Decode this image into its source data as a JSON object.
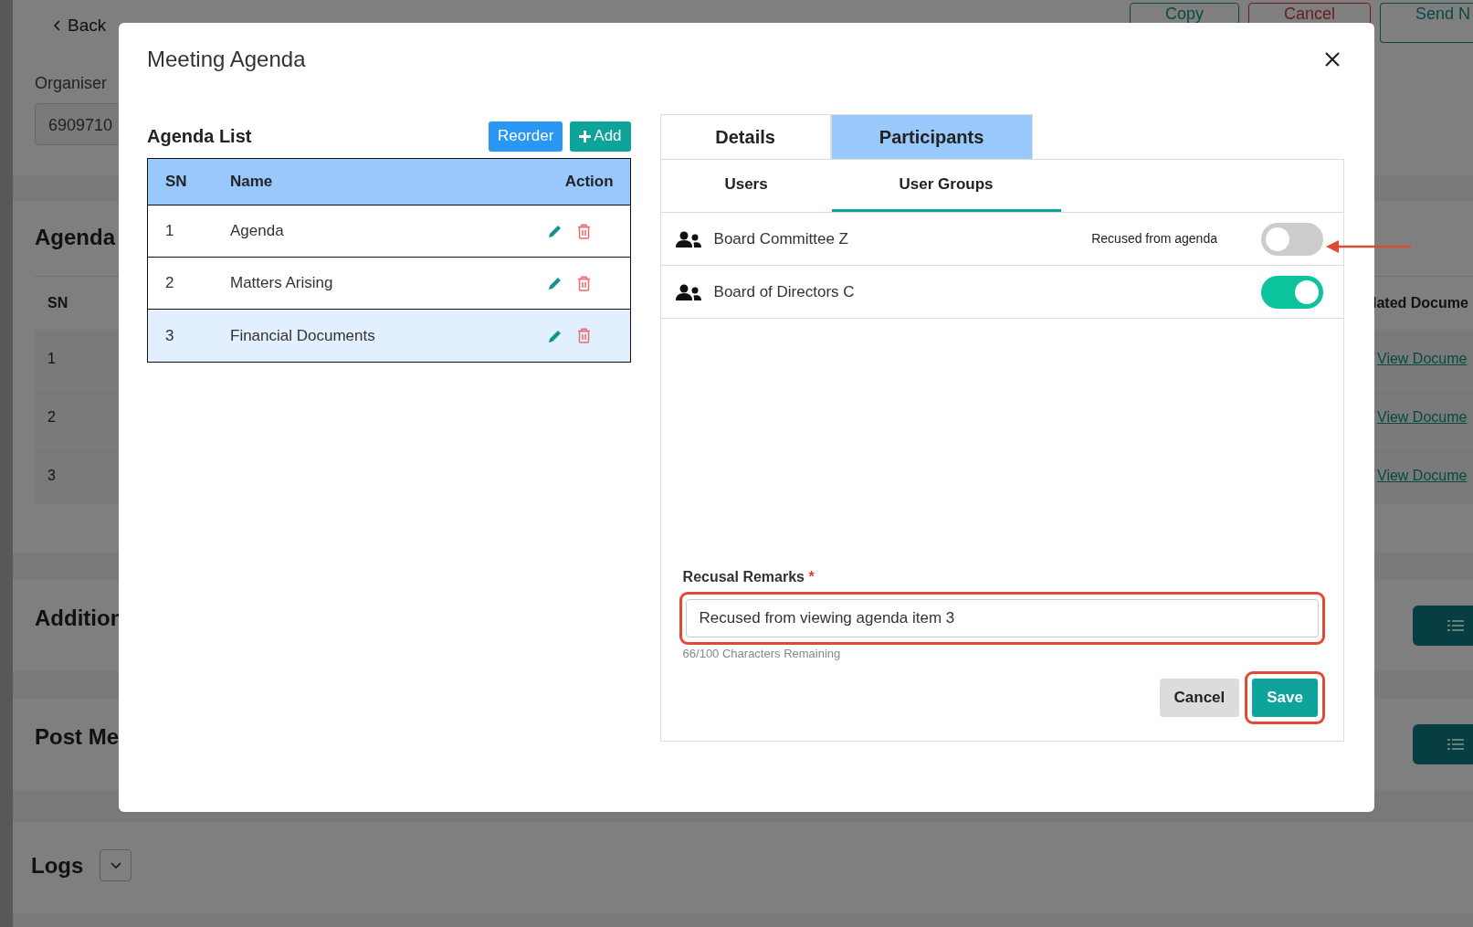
{
  "background": {
    "back_label": "Back",
    "top_buttons": [
      {
        "label": "Copy",
        "kind": "teal"
      },
      {
        "label": "Cancel",
        "kind": "danger"
      },
      {
        "label": "Send N",
        "kind": "teal"
      }
    ],
    "organiser": {
      "label": "Organiser",
      "value": "6909710"
    },
    "agenda": {
      "title": "Agenda",
      "columns": [
        "SN",
        "lated Docume"
      ],
      "rows": [
        {
          "sn": "1",
          "link": "View Docume"
        },
        {
          "sn": "2",
          "link": "View Docume"
        },
        {
          "sn": "3",
          "link": "View Docume"
        }
      ]
    },
    "sections": [
      {
        "title": "Addition"
      },
      {
        "title": "Post Me"
      }
    ],
    "logs": {
      "title": "Logs"
    }
  },
  "modal": {
    "title": "Meeting Agenda",
    "agenda_list": {
      "title": "Agenda List",
      "buttons": [
        {
          "label": "Reorder",
          "kind": "primary"
        },
        {
          "label": "Add",
          "kind": "add"
        }
      ],
      "columns": [
        "SN",
        "Name",
        "Action"
      ],
      "rows": [
        {
          "sn": "1",
          "name": "Agenda",
          "selected": false
        },
        {
          "sn": "2",
          "name": "Matters Arising",
          "selected": false
        },
        {
          "sn": "3",
          "name": "Financial Documents",
          "selected": true
        }
      ]
    },
    "tabs": [
      {
        "label": "Details",
        "selected": false
      },
      {
        "label": "Participants",
        "selected": true
      }
    ],
    "subtabs": [
      {
        "label": "Users",
        "selected": false
      },
      {
        "label": "User Groups",
        "selected": true
      }
    ],
    "groups": [
      {
        "name": "Board Committee Z",
        "note": "Recused from agenda",
        "on": false,
        "pointed": true
      },
      {
        "name": "Board of Directors C",
        "on": true,
        "pointed": false
      }
    ],
    "remarks": {
      "label": "Recusal Remarks",
      "required_mark": "*",
      "value": "Recused from viewing agenda item 3",
      "counter": "66/100 Characters Remaining",
      "highlighted": true
    },
    "buttons": [
      {
        "label": "Cancel",
        "kind": "secondary",
        "highlighted": false
      },
      {
        "label": "Save",
        "kind": "primary",
        "highlighted": true
      }
    ]
  }
}
